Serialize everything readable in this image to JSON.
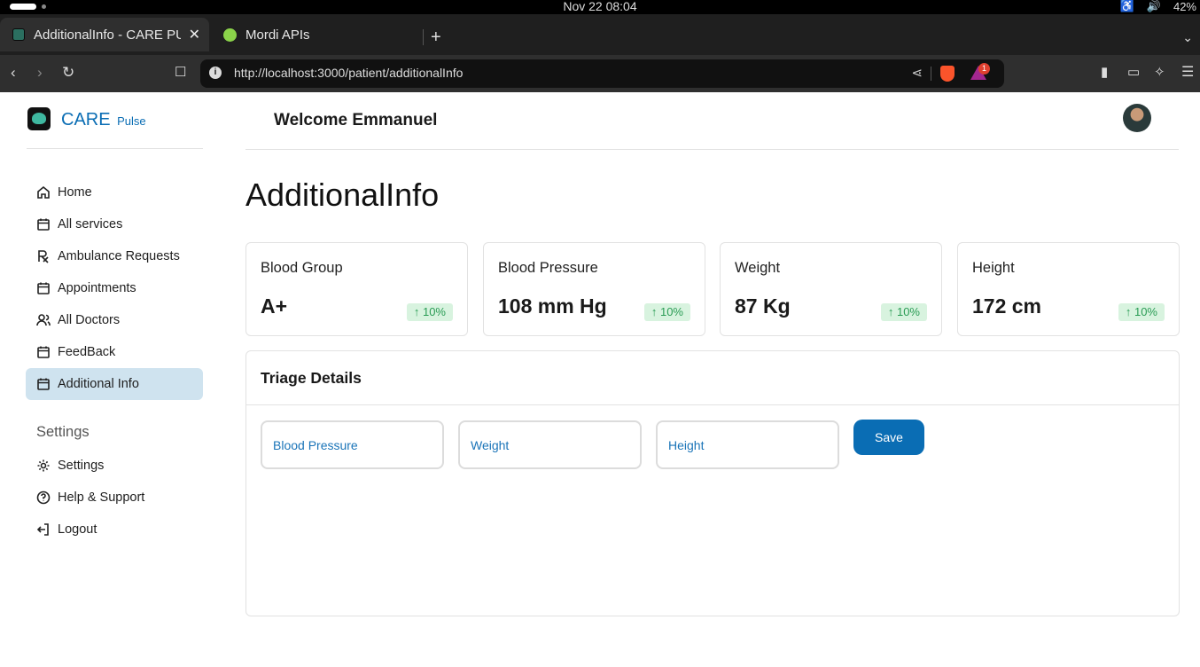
{
  "os": {
    "clock": "Nov 22  08:04",
    "battery": "42%"
  },
  "browser": {
    "tabs": [
      {
        "title": "AdditionalInfo - CARE PULSE",
        "active": true
      },
      {
        "title": "Mordi APIs",
        "active": false
      }
    ],
    "url": "http://localhost:3000/patient/additionalInfo",
    "badge_count": "1"
  },
  "brand": {
    "name": "CARE",
    "suffix": "Pulse",
    "color": "#0a6db4"
  },
  "sidebar": {
    "items": [
      {
        "label": "Home",
        "icon": "home-icon"
      },
      {
        "label": "All services",
        "icon": "calendar-icon"
      },
      {
        "label": "Ambulance Requests",
        "icon": "prescription-icon"
      },
      {
        "label": "Appointments",
        "icon": "calendar-icon"
      },
      {
        "label": "All Doctors",
        "icon": "users-icon"
      },
      {
        "label": "FeedBack",
        "icon": "calendar-icon"
      },
      {
        "label": "Additional Info",
        "icon": "calendar-icon",
        "active": true
      }
    ],
    "settings_heading": "Settings",
    "settings_items": [
      {
        "label": "Settings",
        "icon": "gear-icon"
      },
      {
        "label": "Help & Support",
        "icon": "help-circle-icon"
      },
      {
        "label": "Logout",
        "icon": "logout-icon"
      }
    ]
  },
  "header": {
    "welcome": "Welcome Emmanuel"
  },
  "page": {
    "title": "AdditionalInfo"
  },
  "stats": [
    {
      "label": "Blood Group",
      "value": "A+",
      "trend": "10%"
    },
    {
      "label": "Blood Pressure",
      "value": "108 mm Hg",
      "trend": "10%"
    },
    {
      "label": "Weight",
      "value": "87 Kg",
      "trend": "10%"
    },
    {
      "label": "Height",
      "value": "172 cm",
      "trend": "10%"
    }
  ],
  "triage": {
    "title": "Triage Details",
    "fields": [
      {
        "placeholder": "Blood Pressure",
        "value": ""
      },
      {
        "placeholder": "Weight",
        "value": ""
      },
      {
        "placeholder": "Height",
        "value": ""
      }
    ],
    "save_label": "Save"
  }
}
